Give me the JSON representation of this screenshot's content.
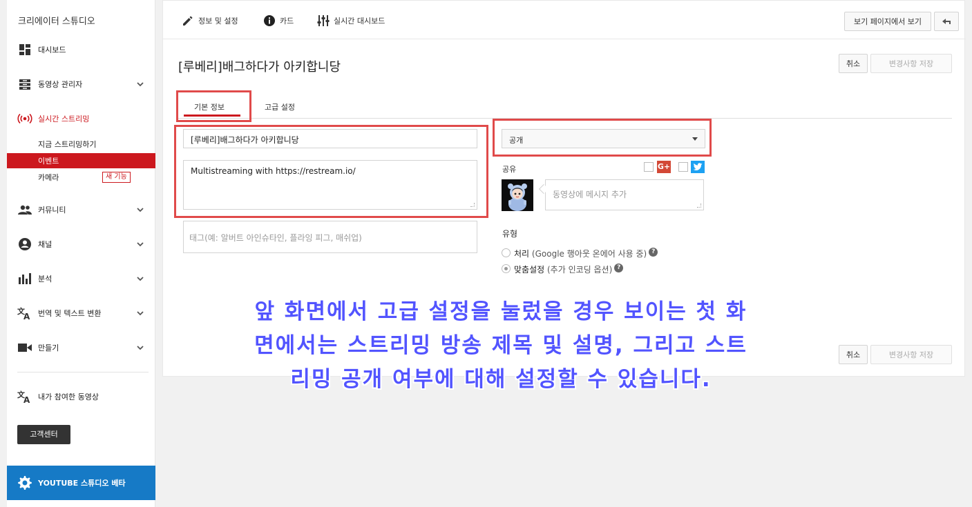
{
  "sidebar": {
    "title": "크리에이터 스튜디오",
    "items": [
      {
        "label": "대시보드",
        "icon": "dashboard-icon"
      },
      {
        "label": "동영상 관리자",
        "icon": "video-manager-icon"
      },
      {
        "label": "실시간 스트리밍",
        "icon": "live-stream-icon"
      },
      {
        "label": "커뮤니티",
        "icon": "community-icon"
      },
      {
        "label": "채널",
        "icon": "channel-icon"
      },
      {
        "label": "분석",
        "icon": "analytics-icon"
      },
      {
        "label": "번역 및 텍스트 변환",
        "icon": "translate-icon"
      },
      {
        "label": "만들기",
        "icon": "create-icon"
      }
    ],
    "live_sub": {
      "stream_now": "지금 스트리밍하기",
      "events": "이벤트",
      "camera": "카메라",
      "new_badge": "새 기능"
    },
    "contributed": "내가 참여한 동영상",
    "help_center": "고객센터",
    "beta": "YOUTUBE 스튜디오 베타",
    "accent_color": "#cc181e"
  },
  "topnav": {
    "info_settings": "정보 및 설정",
    "cards": "카드",
    "live_dashboard": "실시간 대시보드",
    "view_on_watch": "보기 페이지에서 보기"
  },
  "editor": {
    "video_title": "[루베리]배그하다가 아키합니당",
    "cancel": "취소",
    "save": "변경사항 저장",
    "tab_basic": "기본 정보",
    "tab_advanced": "고급 설정",
    "title_value": "[루베리]배그하다가 아키합니당",
    "description_value": "Multistreaming with https://restream.io/",
    "tags_placeholder": "태그(예: 알버트 아인슈타인, 플라잉 피그, 매쉬업)",
    "privacy_value": "공개",
    "share_label": "공유",
    "message_placeholder": "동영상에 메시지 추가",
    "type_label": "유형",
    "type_option1": "처리",
    "type_option1_sub": "(Google 행아웃 온에어 사용 중)",
    "type_option2": "맞춤설정",
    "type_option2_sub": "(추가 인코딩 옵션)",
    "help_glyph": "?",
    "gplus_glyph": "G+"
  },
  "caption": {
    "line1": "앞 화면에서 고급 설정을 눌렀을 경우 보이는 첫 화",
    "line2": "면에서는 스트리밍 방송 제목 및 설명, 그리고 스트",
    "line3": "리밍 공개 여부에 대해 설정할 수 있습니다."
  }
}
